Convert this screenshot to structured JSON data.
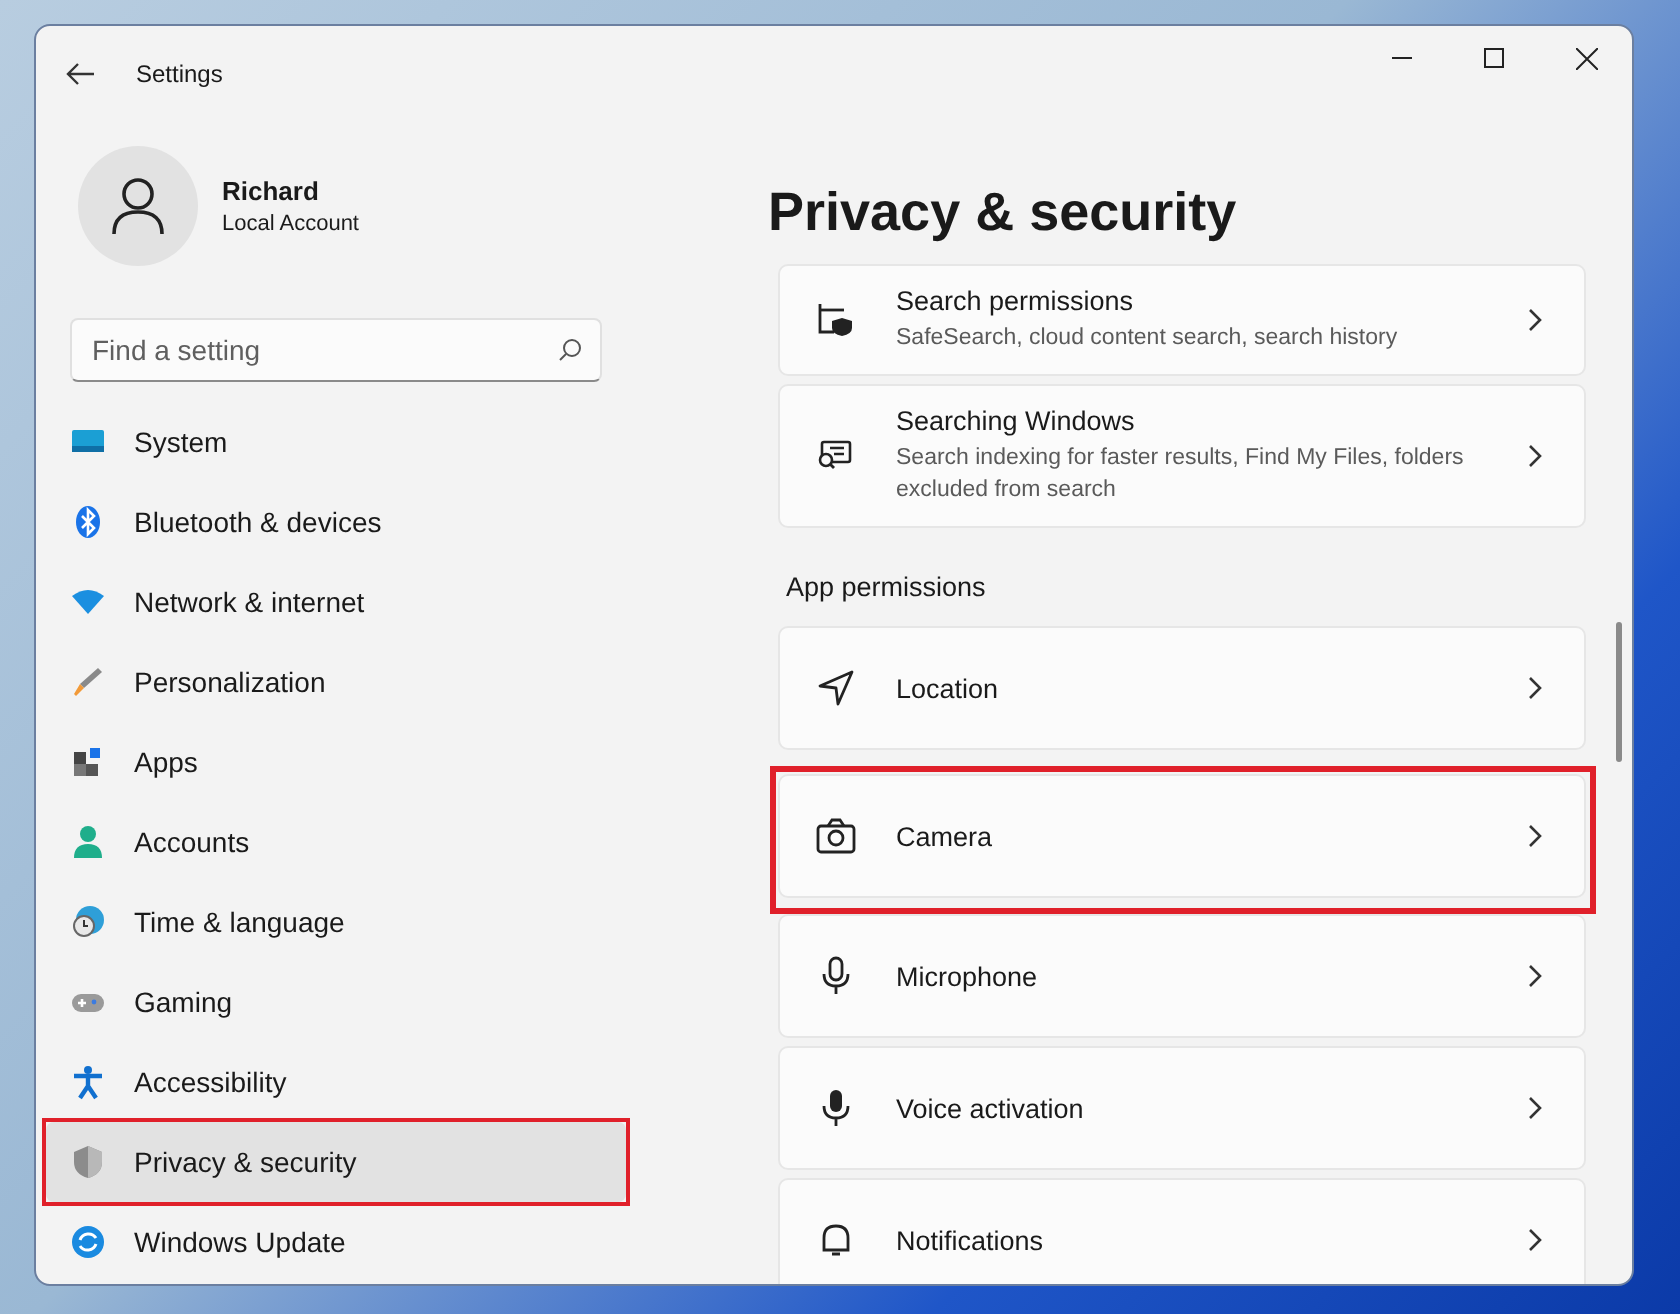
{
  "window": {
    "title": "Settings"
  },
  "profile": {
    "name": "Richard",
    "account": "Local Account"
  },
  "search": {
    "placeholder": "Find a setting"
  },
  "sidebar": {
    "items": [
      {
        "label": "System",
        "selected": false,
        "highlighted": false
      },
      {
        "label": "Bluetooth & devices",
        "selected": false,
        "highlighted": false
      },
      {
        "label": "Network & internet",
        "selected": false,
        "highlighted": false
      },
      {
        "label": "Personalization",
        "selected": false,
        "highlighted": false
      },
      {
        "label": "Apps",
        "selected": false,
        "highlighted": false
      },
      {
        "label": "Accounts",
        "selected": false,
        "highlighted": false
      },
      {
        "label": "Time & language",
        "selected": false,
        "highlighted": false
      },
      {
        "label": "Gaming",
        "selected": false,
        "highlighted": false
      },
      {
        "label": "Accessibility",
        "selected": false,
        "highlighted": false
      },
      {
        "label": "Privacy & security",
        "selected": true,
        "highlighted": true
      },
      {
        "label": "Windows Update",
        "selected": false,
        "highlighted": false
      }
    ]
  },
  "page": {
    "title": "Privacy & security",
    "top_cards": [
      {
        "title": "Search permissions",
        "subtitle": "SafeSearch, cloud content search, search history",
        "highlighted": false
      },
      {
        "title": "Searching Windows",
        "subtitle": "Search indexing for faster results, Find My Files, folders excluded from search",
        "highlighted": false
      }
    ],
    "section": "App permissions",
    "cards": [
      {
        "title": "Location",
        "highlighted": false
      },
      {
        "title": "Camera",
        "highlighted": true
      },
      {
        "title": "Microphone",
        "highlighted": false
      },
      {
        "title": "Voice activation",
        "highlighted": false
      },
      {
        "title": "Notifications",
        "highlighted": false
      }
    ]
  }
}
